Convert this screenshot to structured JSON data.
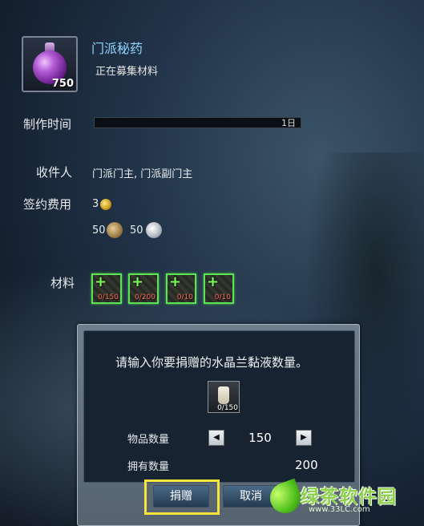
{
  "item": {
    "name": "门派秘药",
    "status": "正在募集材料",
    "count": "750",
    "icon": "purple-potion-icon"
  },
  "craft_time": {
    "label": "制作时间",
    "value": "1日",
    "progress": 0
  },
  "recipient": {
    "label": "收件人",
    "value": "门派门主, 门派副门主"
  },
  "fee": {
    "label": "签约费用",
    "gold": "3",
    "bronze": "50",
    "silver": "50"
  },
  "materials": {
    "label": "材料",
    "slots": [
      {
        "count": "0/150"
      },
      {
        "count": "0/200"
      },
      {
        "count": "0/10"
      },
      {
        "count": "0/10"
      }
    ]
  },
  "dialog": {
    "prompt": "请输入你要捐赠的水晶兰黏液数量。",
    "item_count": "0/150",
    "quantity_label": "物品数量",
    "quantity_value": "150",
    "owned_label": "拥有数量",
    "owned_value": "200",
    "donate_label": "捐赠",
    "cancel_label": "取消"
  },
  "watermark": {
    "text": "绿茶软件园",
    "url": "www.33LC.com"
  },
  "colors": {
    "title": "#8fd6ff",
    "material_border": "#5fe255",
    "highlight": "#f4e63a"
  }
}
